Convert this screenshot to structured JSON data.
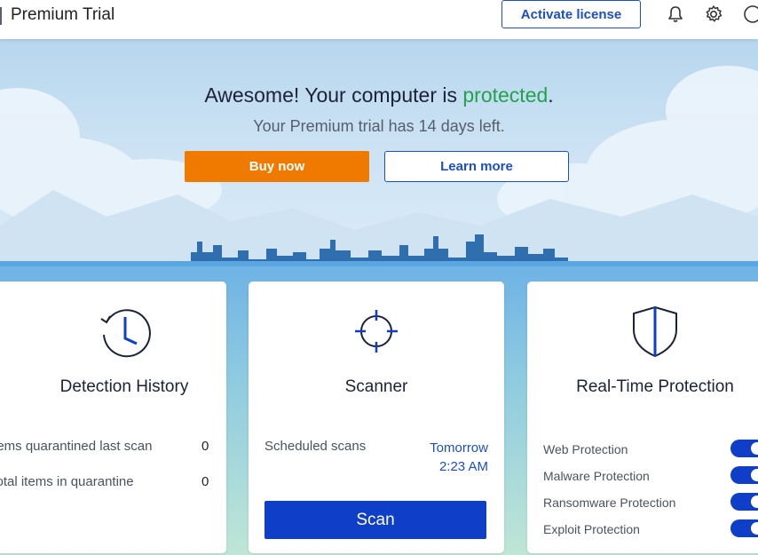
{
  "header": {
    "title": "Premium Trial",
    "activate_label": "Activate license",
    "icons": [
      "bell-icon",
      "gear-icon",
      "help-icon"
    ]
  },
  "hero": {
    "headline_prefix": "Awesome! Your computer is ",
    "headline_status": "protected",
    "headline_suffix": ".",
    "subline": "Your Premium trial has 14 days left.",
    "buy_label": "Buy now",
    "learn_label": "Learn more",
    "status_color": "#22a34a"
  },
  "detection": {
    "title": "Detection History",
    "rows": [
      {
        "label": "Items quarantined last scan",
        "value": "0"
      },
      {
        "label": "Total items in quarantine",
        "value": "0"
      }
    ]
  },
  "scanner": {
    "title": "Scanner",
    "scheduled_label": "Scheduled scans",
    "scheduled_day": "Tomorrow",
    "scheduled_time": "2:23 AM",
    "scan_label": "Scan"
  },
  "rtp": {
    "title": "Real-Time Protection",
    "items": [
      {
        "label": "Web Protection",
        "on": true
      },
      {
        "label": "Malware Protection",
        "on": true
      },
      {
        "label": "Ransomware Protection",
        "on": true
      },
      {
        "label": "Exploit Protection",
        "on": true
      }
    ]
  },
  "colors": {
    "accent": "#0f3fc9",
    "buy": "#f07a00",
    "protected": "#22a34a"
  }
}
